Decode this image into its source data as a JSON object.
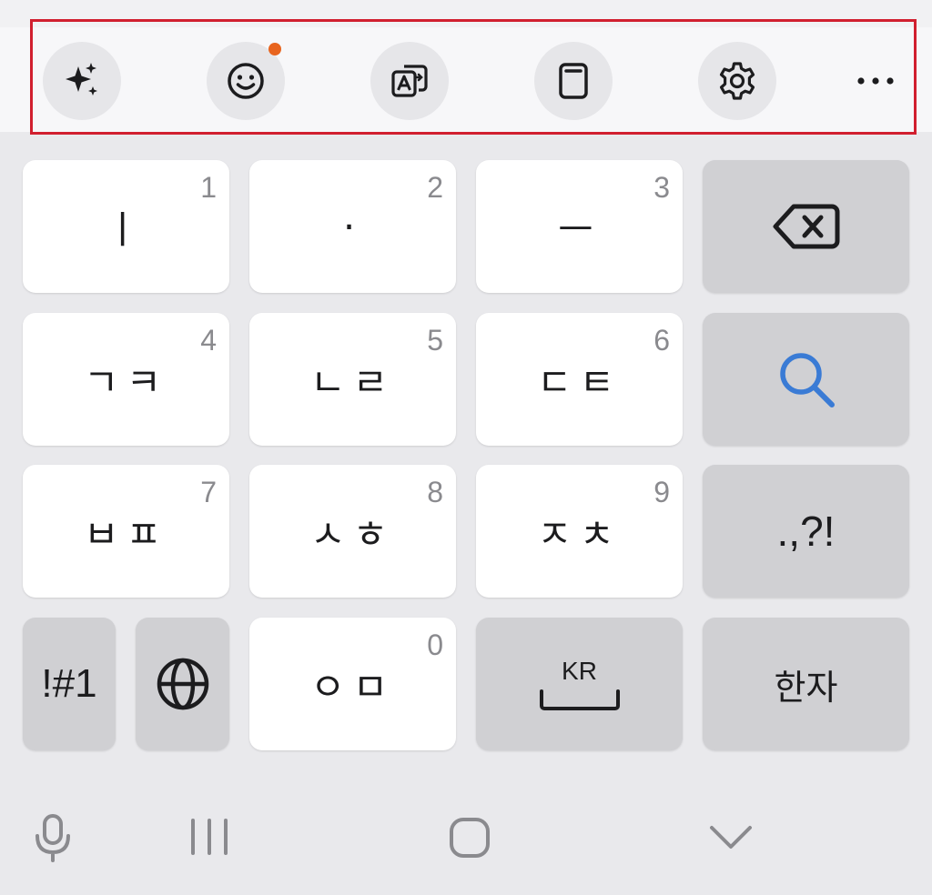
{
  "toolbar": {
    "buttons": [
      {
        "icon": "sparkle-ai-icon"
      },
      {
        "icon": "emoji-icon",
        "has_badge": true
      },
      {
        "icon": "translate-icon"
      },
      {
        "icon": "clipboard-icon"
      },
      {
        "icon": "gear-icon"
      }
    ],
    "more_label": "···",
    "highlight_color": "#d11f2f",
    "badge_color": "#e8641e"
  },
  "keys": {
    "row1": [
      {
        "label": "ㅣ",
        "num": "1"
      },
      {
        "label": "·",
        "num": "2"
      },
      {
        "label": "ㅡ",
        "num": "3"
      }
    ],
    "row2": [
      {
        "label": "ㄱㅋ",
        "num": "4"
      },
      {
        "label": "ㄴㄹ",
        "num": "5"
      },
      {
        "label": "ㄷㅌ",
        "num": "6"
      }
    ],
    "row3": [
      {
        "label": "ㅂㅍ",
        "num": "7"
      },
      {
        "label": "ㅅㅎ",
        "num": "8"
      },
      {
        "label": "ㅈㅊ",
        "num": "9"
      }
    ],
    "row4": {
      "symbols": "!#1",
      "vowel_key": {
        "label": "ㅇㅁ",
        "num": "0"
      },
      "space_label": "KR",
      "hanja": "한자"
    },
    "punct": ".,?!",
    "search_color": "#3a7bd5"
  },
  "nav": {
    "icons": [
      "microphone-icon",
      "recent-apps-icon",
      "home-icon",
      "hide-keyboard-icon"
    ]
  }
}
